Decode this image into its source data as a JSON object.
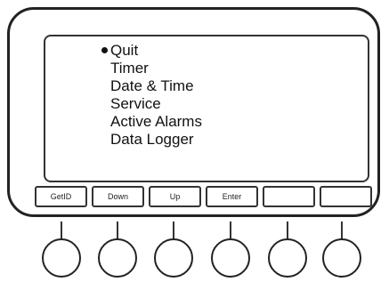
{
  "menu": {
    "items": [
      {
        "label": "Quit",
        "selected": true
      },
      {
        "label": "Timer",
        "selected": false
      },
      {
        "label": "Date & Time",
        "selected": false
      },
      {
        "label": "Service",
        "selected": false
      },
      {
        "label": "Active Alarms",
        "selected": false
      },
      {
        "label": "Data Logger",
        "selected": false
      }
    ]
  },
  "softkeys": [
    {
      "label": "GetID"
    },
    {
      "label": "Down"
    },
    {
      "label": "Up"
    },
    {
      "label": "Enter"
    },
    {
      "label": ""
    },
    {
      "label": ""
    }
  ]
}
